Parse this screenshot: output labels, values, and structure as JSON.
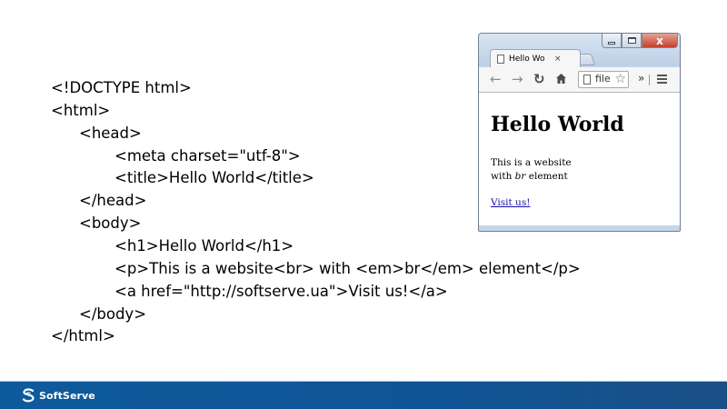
{
  "code_lines": [
    "<!DOCTYPE html>",
    "<html>",
    "<head>",
    "<meta charset=\"utf-8\">",
    "<title>Hello World</title>",
    "</head>",
    "<body>",
    "<h1>Hello World</h1>",
    "<p>This is a website<br> with <em>br</em> element</p>",
    "<a href=\"http://softserve.ua\">Visit us!</a>",
    "</body>",
    "</html>"
  ],
  "browser": {
    "tab_title": "Hello Wo",
    "tab_close": "×",
    "window_close": "x",
    "omnibox_text": "file",
    "toolbar_overflow": "»",
    "icons": {
      "back": "back-arrow-icon",
      "forward": "forward-arrow-icon",
      "reload": "reload-icon",
      "home": "home-icon",
      "bookmark": "star-icon",
      "menu": "hamburger-menu-icon"
    },
    "page": {
      "heading": "Hello World",
      "paragraph_line1": "This is a website",
      "paragraph_line2_pre": "with ",
      "paragraph_line2_em": "br",
      "paragraph_line2_post": " element",
      "link_text": "Visit us!"
    }
  },
  "footer": {
    "brand": "SoftServe",
    "colors": {
      "bar": "#0f5596",
      "accent": "#9fc1e0"
    }
  }
}
